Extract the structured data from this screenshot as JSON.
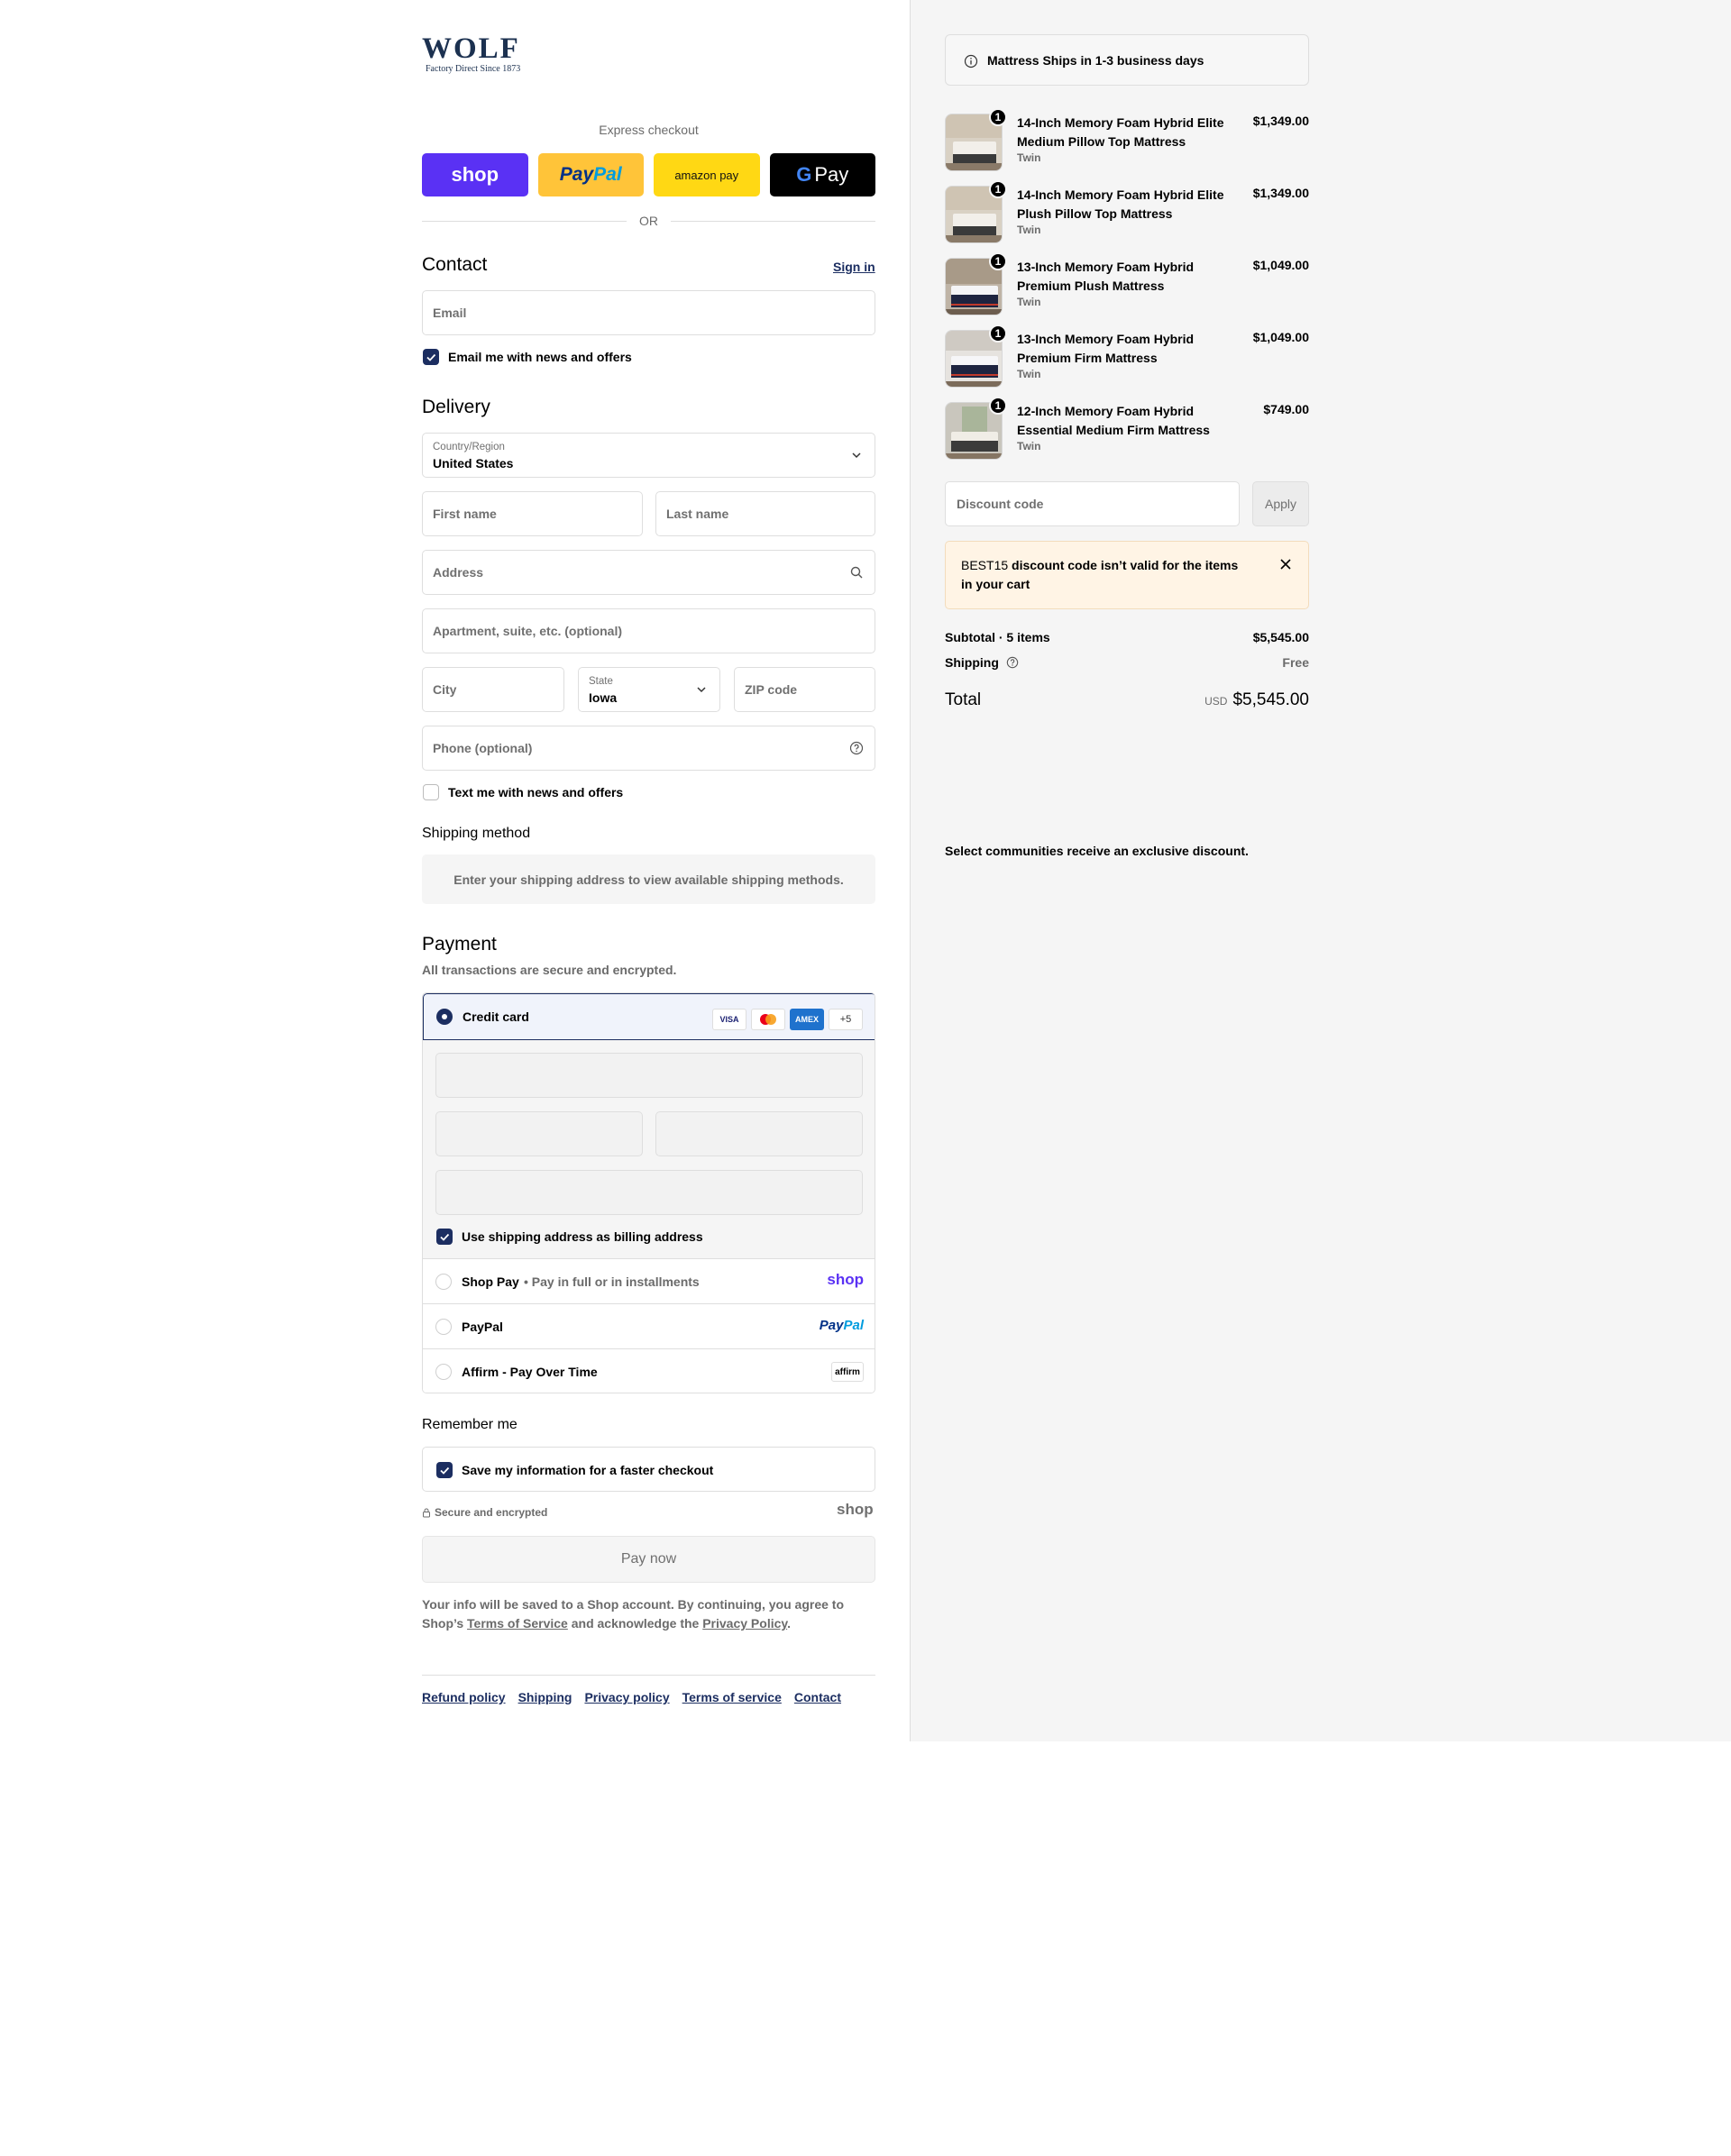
{
  "brand": {
    "name": "WOLF",
    "tagline": "Factory Direct Since 1873"
  },
  "express": {
    "label": "Express checkout",
    "shop": "shop",
    "paypal_a": "Pay",
    "paypal_b": "Pal",
    "amazon": "amazon pay",
    "gpay_g": "G",
    "gpay": "Pay",
    "or": "OR"
  },
  "contact": {
    "title": "Contact",
    "sign_in": "Sign in",
    "email_placeholder": "Email",
    "newsletter": "Email me with news and offers"
  },
  "delivery": {
    "title": "Delivery",
    "country_label": "Country/Region",
    "country_value": "United States",
    "first_name": "First name",
    "last_name": "Last name",
    "address": "Address",
    "apartment": "Apartment, suite, etc. (optional)",
    "city": "City",
    "state_label": "State",
    "state_value": "Iowa",
    "zip": "ZIP code",
    "phone": "Phone (optional)",
    "sms": "Text me with news and offers"
  },
  "shipping_method": {
    "title": "Shipping method",
    "notice": "Enter your shipping address to view available shipping methods."
  },
  "payment": {
    "title": "Payment",
    "subtitle": "All transactions are secure and encrypted.",
    "credit_card": "Credit card",
    "cards": [
      "VISA",
      "",
      "AMEX",
      "+5"
    ],
    "billing_same": "Use shipping address as billing address",
    "shop_pay": "Shop Pay",
    "shop_pay_note": "• Pay in full or in installments",
    "shop_pay_logo": "shop",
    "paypal": "PayPal",
    "paypal_logo_a": "Pay",
    "paypal_logo_b": "Pal",
    "affirm": "Affirm - Pay Over Time",
    "affirm_logo": "affirm"
  },
  "remember": {
    "title": "Remember me",
    "save": "Save my information for a faster checkout",
    "secure": "Secure and encrypted",
    "shop_logo": "shop"
  },
  "pay_now": "Pay now",
  "legal": {
    "text1": "Your info will be saved to a Shop account. By continuing, you agree to Shop’s ",
    "terms": "Terms of Service",
    "text2": " and acknowledge the ",
    "privacy": "Privacy Policy",
    "text3": "."
  },
  "footer": [
    "Refund policy",
    "Shipping",
    "Privacy policy",
    "Terms of service",
    "Contact"
  ],
  "summary": {
    "ship_notice": "Mattress Ships in 1-3 business days",
    "items": [
      {
        "name": "14-Inch Memory Foam Hybrid Elite Medium Pillow Top Mattress",
        "variant": "Twin",
        "price": "$1,349.00",
        "qty": "1"
      },
      {
        "name": "14-Inch Memory Foam Hybrid Elite Plush Pillow Top Mattress",
        "variant": "Twin",
        "price": "$1,349.00",
        "qty": "1"
      },
      {
        "name": "13-Inch Memory Foam Hybrid Premium Plush Mattress",
        "variant": "Twin",
        "price": "$1,049.00",
        "qty": "1"
      },
      {
        "name": "13-Inch Memory Foam Hybrid Premium Firm Mattress",
        "variant": "Twin",
        "price": "$1,049.00",
        "qty": "1"
      },
      {
        "name": "12-Inch Memory Foam Hybrid Essential Medium Firm Mattress",
        "variant": "Twin",
        "price": "$749.00",
        "qty": "1"
      }
    ],
    "discount_placeholder": "Discount code",
    "apply": "Apply",
    "error_code": "BEST15",
    "error_text": " discount code isn’t valid for the items in your cart",
    "subtotal_label": "Subtotal · 5 items",
    "subtotal_value": "$5,545.00",
    "shipping_label": "Shipping",
    "shipping_value": "Free",
    "total_label": "Total",
    "currency": "USD",
    "total_value": "$5,545.00",
    "promo": "Select communities receive an exclusive discount."
  },
  "colors": {
    "accent": "#1c2e61",
    "shop_purple": "#5a31f4",
    "paypal_yellow": "#ffc439",
    "amazon_yellow": "#ffd814",
    "summary_bg": "#f5f5f5",
    "error_bg": "#fff4e5"
  }
}
